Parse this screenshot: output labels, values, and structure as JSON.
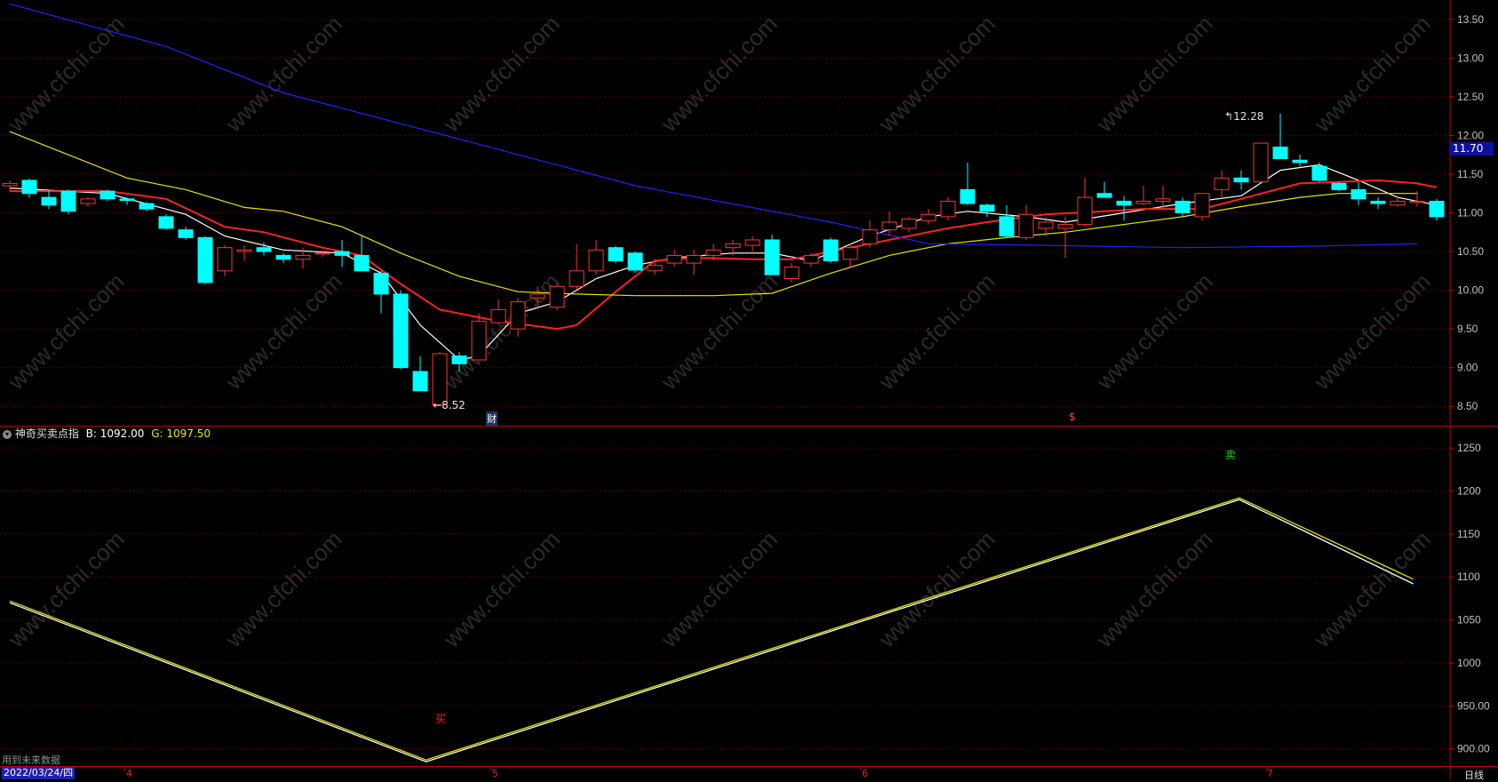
{
  "watermark": "www.cfchi.com",
  "price_badge": "11.70",
  "markers": {
    "low": "8.52",
    "high": "12.28",
    "cai": "财",
    "dollar": "$"
  },
  "indicator": {
    "name": "神奇买卖点指",
    "b_label": "B:",
    "b_value": "1092.00",
    "g_label": "G:",
    "g_value": "1097.50",
    "buy_label": "买",
    "sell_label": "卖",
    "future_note": "用到未来数据"
  },
  "footer": {
    "date": "2022/03/24/四",
    "period": "日线",
    "months": [
      "4",
      "5",
      "6",
      "7"
    ]
  },
  "colors": {
    "up": "#ff3232",
    "down": "#00ffff",
    "ma5": "#ffffff",
    "ma10": "#ff2020",
    "ma20": "#e6e600",
    "ma60": "#2020ff",
    "axis": "#c00000",
    "label": "#c0c0c0"
  },
  "chart_data": [
    {
      "type": "candlestick",
      "ylim": [
        8.25,
        13.75
      ],
      "yticks": [
        "13.50",
        "13.00",
        "12.50",
        "12.00",
        "11.50",
        "11.00",
        "10.50",
        "10.00",
        "9.50",
        "9.00",
        "8.50"
      ],
      "candles": [
        [
          11.35,
          11.42,
          11.28,
          11.38
        ],
        [
          11.42,
          11.44,
          11.2,
          11.25
        ],
        [
          11.2,
          11.3,
          11.05,
          11.1
        ],
        [
          11.28,
          11.3,
          10.98,
          11.02
        ],
        [
          11.12,
          11.2,
          11.08,
          11.18
        ],
        [
          11.28,
          11.3,
          11.15,
          11.18
        ],
        [
          11.18,
          11.2,
          11.1,
          11.16
        ],
        [
          11.12,
          11.14,
          11.02,
          11.05
        ],
        [
          10.95,
          10.98,
          10.78,
          10.8
        ],
        [
          10.78,
          10.82,
          10.65,
          10.68
        ],
        [
          10.68,
          10.7,
          10.08,
          10.1
        ],
        [
          10.25,
          10.58,
          10.18,
          10.55
        ],
        [
          10.5,
          10.58,
          10.38,
          10.52
        ],
        [
          10.55,
          10.62,
          10.45,
          10.5
        ],
        [
          10.45,
          10.48,
          10.35,
          10.4
        ],
        [
          10.4,
          10.55,
          10.28,
          10.45
        ],
        [
          10.48,
          10.52,
          10.43,
          10.48
        ],
        [
          10.5,
          10.65,
          10.3,
          10.45
        ],
        [
          10.45,
          10.72,
          10.25,
          10.25
        ],
        [
          10.22,
          10.25,
          9.7,
          9.95
        ],
        [
          9.95,
          10.0,
          8.98,
          9.0
        ],
        [
          8.95,
          9.15,
          8.7,
          8.7
        ],
        [
          8.52,
          9.2,
          8.52,
          9.18
        ],
        [
          9.15,
          9.2,
          8.95,
          9.05
        ],
        [
          9.1,
          9.7,
          9.1,
          9.6
        ],
        [
          9.58,
          9.88,
          9.55,
          9.75
        ],
        [
          9.5,
          9.9,
          9.4,
          9.85
        ],
        [
          9.9,
          10.05,
          9.75,
          9.95
        ],
        [
          9.78,
          10.08,
          9.74,
          10.05
        ],
        [
          10.05,
          10.6,
          10.0,
          10.25
        ],
        [
          10.25,
          10.65,
          10.2,
          10.52
        ],
        [
          10.55,
          10.57,
          10.35,
          10.38
        ],
        [
          10.48,
          10.5,
          10.22,
          10.26
        ],
        [
          10.25,
          10.4,
          10.2,
          10.32
        ],
        [
          10.35,
          10.52,
          10.3,
          10.45
        ],
        [
          10.35,
          10.52,
          10.2,
          10.45
        ],
        [
          10.45,
          10.6,
          10.38,
          10.52
        ],
        [
          10.55,
          10.65,
          10.45,
          10.6
        ],
        [
          10.58,
          10.7,
          10.5,
          10.65
        ],
        [
          10.65,
          10.72,
          10.2,
          10.2
        ],
        [
          10.15,
          10.35,
          10.1,
          10.3
        ],
        [
          10.35,
          10.48,
          10.3,
          10.45
        ],
        [
          10.65,
          10.68,
          10.35,
          10.38
        ],
        [
          10.4,
          10.6,
          10.3,
          10.55
        ],
        [
          10.6,
          10.9,
          10.55,
          10.78
        ],
        [
          10.78,
          11.02,
          10.7,
          10.88
        ],
        [
          10.8,
          10.95,
          10.75,
          10.92
        ],
        [
          10.9,
          11.05,
          10.85,
          10.98
        ],
        [
          10.95,
          11.2,
          10.9,
          11.15
        ],
        [
          11.3,
          11.65,
          11.1,
          11.12
        ],
        [
          11.1,
          11.12,
          10.95,
          11.02
        ],
        [
          10.95,
          11.1,
          10.68,
          10.7
        ],
        [
          10.68,
          11.1,
          10.65,
          10.98
        ],
        [
          10.8,
          10.95,
          10.7,
          10.88
        ],
        [
          10.8,
          10.95,
          10.42,
          10.85
        ],
        [
          10.85,
          11.45,
          10.82,
          11.2
        ],
        [
          11.25,
          11.4,
          11.2,
          11.2
        ],
        [
          11.15,
          11.22,
          10.9,
          11.1
        ],
        [
          11.12,
          11.35,
          11.1,
          11.15
        ],
        [
          11.15,
          11.35,
          11.05,
          11.18
        ],
        [
          11.15,
          11.2,
          10.95,
          11.0
        ],
        [
          10.95,
          11.25,
          10.9,
          11.25
        ],
        [
          11.3,
          11.55,
          11.2,
          11.45
        ],
        [
          11.45,
          11.55,
          11.3,
          11.4
        ],
        [
          11.4,
          11.9,
          11.4,
          11.9
        ],
        [
          11.85,
          12.28,
          11.8,
          11.7
        ],
        [
          11.68,
          11.75,
          11.6,
          11.65
        ],
        [
          11.6,
          11.65,
          11.4,
          11.42
        ],
        [
          11.38,
          11.4,
          11.28,
          11.3
        ],
        [
          11.3,
          11.4,
          11.1,
          11.18
        ],
        [
          11.15,
          11.2,
          11.05,
          11.12
        ],
        [
          11.1,
          11.22,
          11.08,
          11.15
        ],
        [
          11.15,
          11.28,
          11.08,
          11.15
        ],
        [
          11.15,
          11.18,
          10.9,
          10.95
        ]
      ],
      "ma_lines": [
        {
          "name": "MA5",
          "color": "#ffffff",
          "points": [
            [
              0,
              11.32
            ],
            [
              5,
              11.25
            ],
            [
              9,
              10.98
            ],
            [
              11,
              10.7
            ],
            [
              14,
              10.52
            ],
            [
              17,
              10.48
            ],
            [
              19,
              10.22
            ],
            [
              21,
              9.55
            ],
            [
              23,
              9.1
            ],
            [
              24,
              9.15
            ],
            [
              26,
              9.7
            ],
            [
              28,
              9.85
            ],
            [
              30,
              10.15
            ],
            [
              32,
              10.32
            ],
            [
              34,
              10.42
            ],
            [
              37,
              10.48
            ],
            [
              39,
              10.48
            ],
            [
              41,
              10.38
            ],
            [
              44,
              10.7
            ],
            [
              47,
              10.95
            ],
            [
              49,
              11.02
            ],
            [
              52,
              10.95
            ],
            [
              54,
              10.88
            ],
            [
              57,
              11.0
            ],
            [
              60,
              11.12
            ],
            [
              63,
              11.22
            ],
            [
              65,
              11.55
            ],
            [
              67,
              11.62
            ],
            [
              69,
              11.42
            ],
            [
              71,
              11.2
            ],
            [
              73,
              11.1
            ]
          ]
        },
        {
          "name": "MA10",
          "color": "#ff2020",
          "points": [
            [
              0,
              11.28
            ],
            [
              3,
              11.28
            ],
            [
              5,
              11.28
            ],
            [
              8,
              11.18
            ],
            [
              11,
              10.82
            ],
            [
              13,
              10.75
            ],
            [
              16,
              10.55
            ],
            [
              18,
              10.45
            ],
            [
              20,
              10.08
            ],
            [
              22,
              9.75
            ],
            [
              25,
              9.6
            ],
            [
              28,
              9.5
            ],
            [
              29,
              9.55
            ],
            [
              31,
              9.98
            ],
            [
              33,
              10.38
            ],
            [
              35,
              10.42
            ],
            [
              38,
              10.4
            ],
            [
              40,
              10.4
            ],
            [
              43,
              10.55
            ],
            [
              46,
              10.7
            ],
            [
              48,
              10.8
            ],
            [
              50,
              10.88
            ],
            [
              53,
              10.98
            ],
            [
              56,
              11.02
            ],
            [
              58,
              11.05
            ],
            [
              61,
              11.05
            ],
            [
              63,
              11.18
            ],
            [
              66,
              11.38
            ],
            [
              68,
              11.4
            ],
            [
              70,
              11.42
            ],
            [
              72,
              11.38
            ],
            [
              73,
              11.33
            ]
          ]
        },
        {
          "name": "MA20",
          "color": "#e6e600",
          "points": [
            [
              0,
              12.05
            ],
            [
              3,
              11.75
            ],
            [
              6,
              11.45
            ],
            [
              9,
              11.3
            ],
            [
              12,
              11.07
            ],
            [
              14,
              11.02
            ],
            [
              17,
              10.82
            ],
            [
              20,
              10.48
            ],
            [
              23,
              10.18
            ],
            [
              26,
              9.98
            ],
            [
              29,
              9.95
            ],
            [
              32,
              9.93
            ],
            [
              36,
              9.93
            ],
            [
              39,
              9.96
            ],
            [
              42,
              10.22
            ],
            [
              45,
              10.45
            ],
            [
              48,
              10.6
            ],
            [
              51,
              10.68
            ],
            [
              54,
              10.75
            ],
            [
              57,
              10.85
            ],
            [
              60,
              10.95
            ],
            [
              63,
              11.08
            ],
            [
              66,
              11.2
            ],
            [
              68,
              11.25
            ],
            [
              70,
              11.25
            ],
            [
              72,
              11.25
            ]
          ]
        },
        {
          "name": "MA60",
          "color": "#2020ff",
          "points": [
            [
              0,
              13.7
            ],
            [
              8,
              13.15
            ],
            [
              14,
              12.55
            ],
            [
              22,
              12.02
            ],
            [
              32,
              11.35
            ],
            [
              42,
              10.88
            ],
            [
              47,
              10.6
            ],
            [
              53,
              10.58
            ],
            [
              60,
              10.55
            ],
            [
              67,
              10.57
            ],
            [
              72,
              10.6
            ]
          ]
        }
      ]
    },
    {
      "type": "line",
      "ylim": [
        880,
        1275
      ],
      "yticks": [
        "1250",
        "1200",
        "1150",
        "1100",
        "1050",
        "1000",
        "950.00",
        "900.00"
      ],
      "series": [
        {
          "name": "B",
          "color": "#ffffff",
          "points": [
            [
              0,
              1070
            ],
            [
              21.3,
              885
            ],
            [
              62.9,
              1190
            ],
            [
              71.8,
              1092
            ]
          ]
        },
        {
          "name": "G",
          "color": "#e6e600",
          "points": [
            [
              0,
              1072
            ],
            [
              21.3,
              887
            ],
            [
              62.9,
              1192
            ],
            [
              71.8,
              1097.5
            ]
          ]
        }
      ]
    }
  ]
}
